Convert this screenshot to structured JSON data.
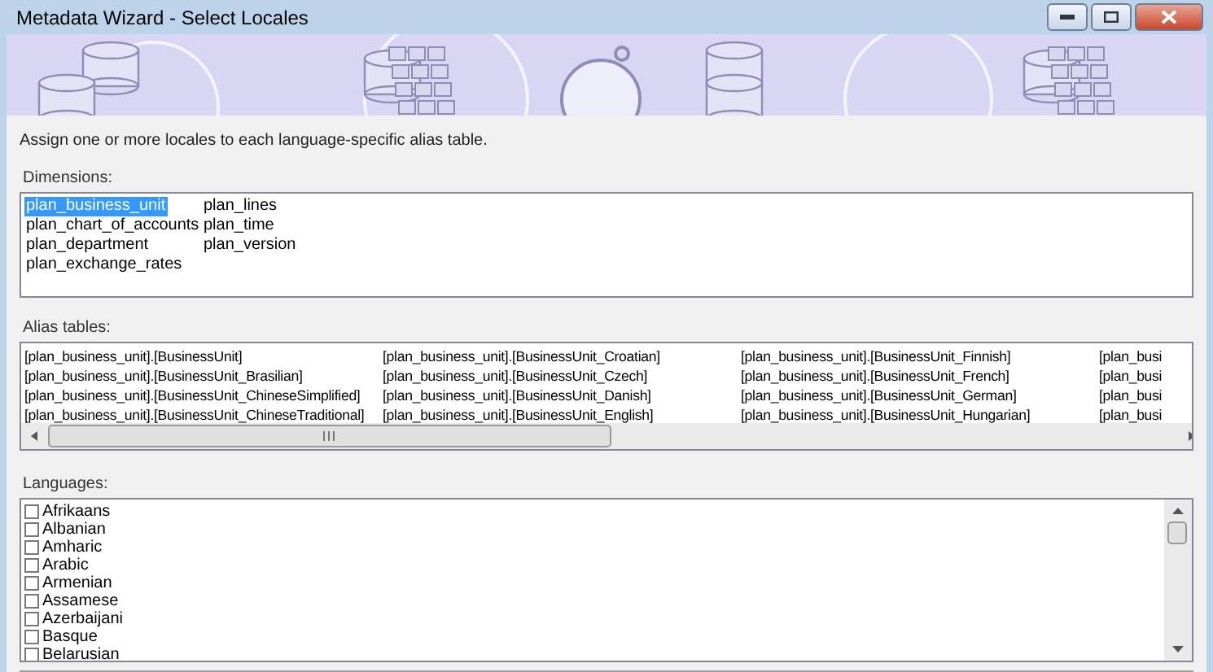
{
  "window": {
    "title": "Metadata Wizard - Select Locales"
  },
  "instruction": "Assign one or more locales to each language-specific alias table.",
  "dimensions": {
    "label": "Dimensions:",
    "columns": [
      [
        {
          "text": "plan_business_unit",
          "selected": true
        },
        {
          "text": "plan_chart_of_accounts",
          "selected": false
        },
        {
          "text": "plan_department",
          "selected": false
        },
        {
          "text": "plan_exchange_rates",
          "selected": false
        }
      ],
      [
        {
          "text": "plan_lines",
          "selected": false
        },
        {
          "text": "plan_time",
          "selected": false
        },
        {
          "text": "plan_version",
          "selected": false
        }
      ]
    ]
  },
  "alias_tables": {
    "label": "Alias tables:",
    "columns": [
      [
        "[plan_business_unit].[BusinessUnit]",
        "[plan_business_unit].[BusinessUnit_Brasilian]",
        "[plan_business_unit].[BusinessUnit_ChineseSimplified]",
        "[plan_business_unit].[BusinessUnit_ChineseTraditional]"
      ],
      [
        "[plan_business_unit].[BusinessUnit_Croatian]",
        "[plan_business_unit].[BusinessUnit_Czech]",
        "[plan_business_unit].[BusinessUnit_Danish]",
        "[plan_business_unit].[BusinessUnit_English]"
      ],
      [
        "[plan_business_unit].[BusinessUnit_Finnish]",
        "[plan_business_unit].[BusinessUnit_French]",
        "[plan_business_unit].[BusinessUnit_German]",
        "[plan_business_unit].[BusinessUnit_Hungarian]"
      ],
      [
        "[plan_busi",
        "[plan_busi",
        "[plan_busi",
        "[plan_busi"
      ]
    ]
  },
  "languages": {
    "label": "Languages:",
    "items": [
      {
        "name": "Afrikaans",
        "checked": false
      },
      {
        "name": "Albanian",
        "checked": false
      },
      {
        "name": "Amharic",
        "checked": false
      },
      {
        "name": "Arabic",
        "checked": false
      },
      {
        "name": "Armenian",
        "checked": false
      },
      {
        "name": "Assamese",
        "checked": false
      },
      {
        "name": "Azerbaijani",
        "checked": false
      },
      {
        "name": "Basque",
        "checked": false
      },
      {
        "name": "Belarusian",
        "checked": false
      }
    ]
  }
}
